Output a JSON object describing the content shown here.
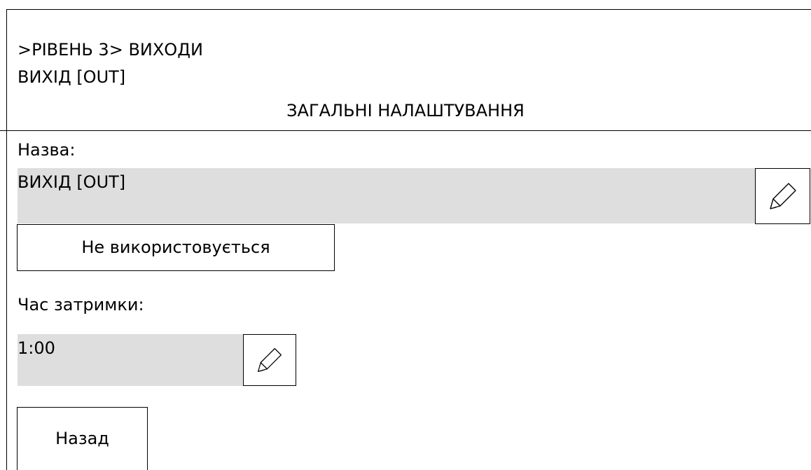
{
  "breadcrumb": {
    "path": ">РІВЕНЬ 3> ВИХОДИ",
    "current": "ВИХІД [OUT]"
  },
  "section": {
    "title": "ЗАГАЛЬНІ НАЛАШТУВАННЯ"
  },
  "name_field": {
    "label": "Назва:",
    "value": "ВИХІД [OUT]",
    "edit_icon": "pencil-icon"
  },
  "mode_button": {
    "label": "Не використовується"
  },
  "delay_field": {
    "label": "Час затримки:",
    "value": "1:00",
    "edit_icon": "pencil-icon"
  },
  "back_button": {
    "label": "Назад"
  },
  "colors": {
    "field_background": "#dedede",
    "border": "#000000",
    "background": "#ffffff"
  }
}
